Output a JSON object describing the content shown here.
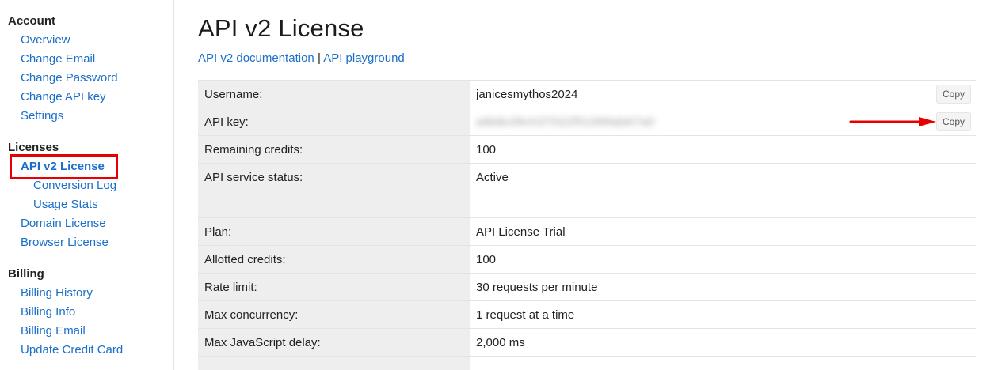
{
  "sidebar": {
    "account": {
      "heading": "Account",
      "items": [
        {
          "label": "Overview"
        },
        {
          "label": "Change Email"
        },
        {
          "label": "Change Password"
        },
        {
          "label": "Change API key"
        },
        {
          "label": "Settings"
        }
      ]
    },
    "licenses": {
      "heading": "Licenses",
      "items": [
        {
          "label": "API v2 License"
        },
        {
          "label": "Conversion Log"
        },
        {
          "label": "Usage Stats"
        },
        {
          "label": "Domain License"
        },
        {
          "label": "Browser License"
        }
      ]
    },
    "billing": {
      "heading": "Billing",
      "items": [
        {
          "label": "Billing History"
        },
        {
          "label": "Billing Info"
        },
        {
          "label": "Billing Email"
        },
        {
          "label": "Update Credit Card"
        }
      ]
    }
  },
  "main": {
    "title": "API v2 License",
    "doc_link": "API v2 documentation",
    "separator": "|",
    "playground_link": "API playground",
    "copy_label": "Copy",
    "rows": {
      "username": {
        "label": "Username:",
        "value": "janicesmythos2024"
      },
      "api_key": {
        "label": "API key:",
        "value": "a6b8c0fe41f7022f51999ab67a0"
      },
      "remaining_credits": {
        "label": "Remaining credits:",
        "value": "100"
      },
      "service_status": {
        "label": "API service status:",
        "value": "Active"
      },
      "plan": {
        "label": "Plan:",
        "value": "API License Trial"
      },
      "allotted_credits": {
        "label": "Allotted credits:",
        "value": "100"
      },
      "rate_limit": {
        "label": "Rate limit:",
        "value": "30 requests per minute"
      },
      "max_concurrency": {
        "label": "Max concurrency:",
        "value": "1 request at a time"
      },
      "max_js_delay": {
        "label": "Max JavaScript delay:",
        "value": "2,000 ms"
      }
    }
  },
  "colors": {
    "link": "#1a6fc9",
    "highlight": "#e60000",
    "label_bg": "#eeeeee"
  }
}
